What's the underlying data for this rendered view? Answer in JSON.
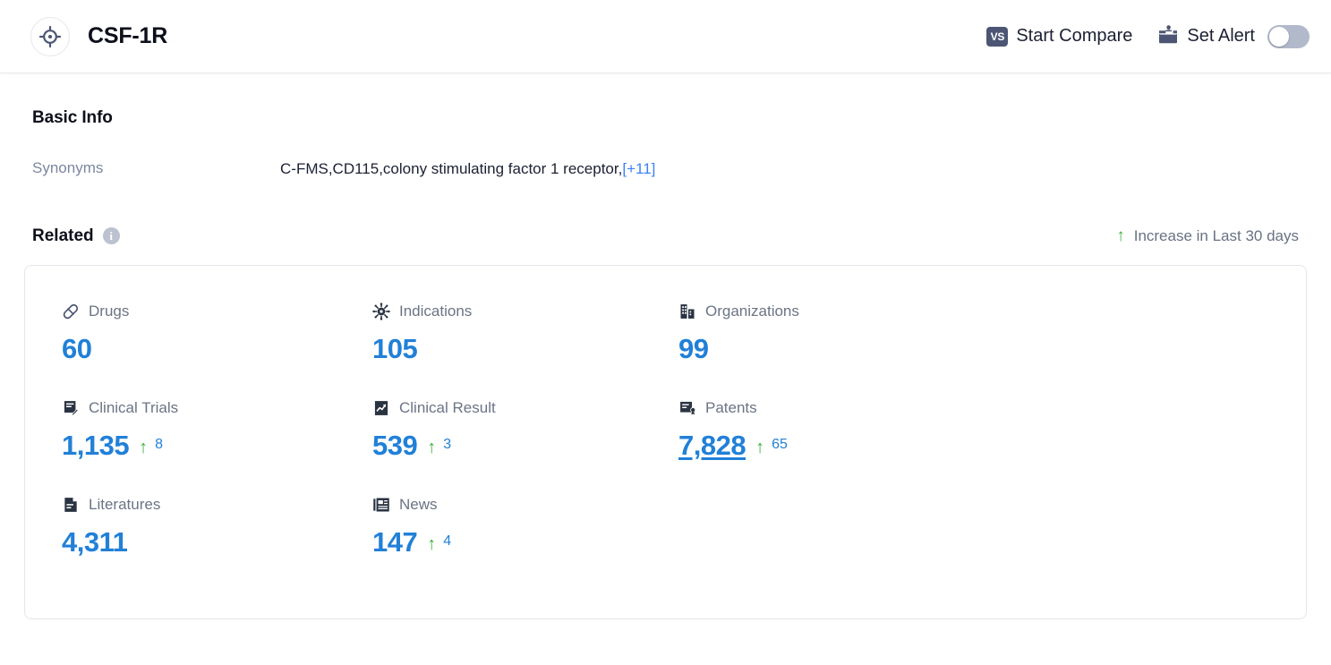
{
  "header": {
    "entity_icon": "target-crosshair-icon",
    "title": "CSF-1R",
    "compare": {
      "badge": "VS",
      "label": "Start Compare",
      "icon": "vs-badge-icon"
    },
    "alert": {
      "label": "Set Alert",
      "icon": "alert-inbox-bell-icon",
      "toggle_state": "off"
    }
  },
  "basic_info": {
    "title": "Basic Info",
    "synonyms_label": "Synonyms",
    "synonyms_value": "C-FMS,CD115,colony stimulating factor 1 receptor,",
    "synonyms_more": "[+11]"
  },
  "related": {
    "title": "Related",
    "info_icon": "info-circle-icon",
    "legend_arrow": "↑",
    "legend_text": "Increase in Last 30 days",
    "accent_blue": "#2180d8",
    "increase_green": "#3fae3a",
    "items": [
      {
        "label": "Drugs",
        "icon": "pill-capsule-icon",
        "value": "60",
        "delta": ""
      },
      {
        "label": "Indications",
        "icon": "virus-icon",
        "value": "105",
        "delta": ""
      },
      {
        "label": "Organizations",
        "icon": "building-icon",
        "value": "99",
        "delta": ""
      },
      {
        "label": "Clinical Trials",
        "icon": "document-pencil-icon",
        "value": "1,135",
        "delta": "8"
      },
      {
        "label": "Clinical Result",
        "icon": "document-chart-icon",
        "value": "539",
        "delta": "3"
      },
      {
        "label": "Patents",
        "icon": "patent-certificate-icon",
        "value": "7,828",
        "delta": "65"
      },
      {
        "label": "Literatures",
        "icon": "document-text-icon",
        "value": "4,311",
        "delta": ""
      },
      {
        "label": "News",
        "icon": "newspaper-icon",
        "value": "147",
        "delta": "4"
      }
    ]
  }
}
